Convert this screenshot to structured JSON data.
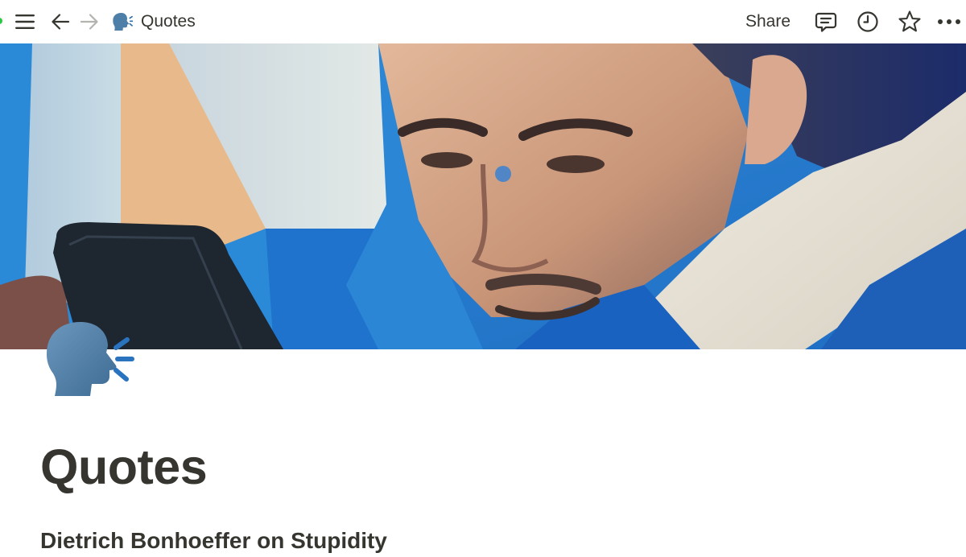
{
  "topbar": {
    "menu_icon": "hamburger-menu-icon",
    "back_icon": "arrow-left-icon",
    "forward_icon": "arrow-right-icon",
    "breadcrumb": {
      "icon": "speaking-head-emoji",
      "label": "Quotes"
    },
    "share_label": "Share",
    "comments_icon": "comment-icon",
    "updates_icon": "clock-icon",
    "favorite_icon": "star-icon",
    "more_icon": "more-horizontal-icon"
  },
  "cover": {
    "description_icon": "cover-photo"
  },
  "page": {
    "icon": "speaking-head-emoji",
    "title": "Quotes",
    "first_heading": "Dietrich Bonhoeffer on Stupidity"
  },
  "colors": {
    "text": "#37352f",
    "icon_gray": "#37352f",
    "disabled_arrow": "#b4b3b0",
    "window_dot": "#28c840"
  }
}
